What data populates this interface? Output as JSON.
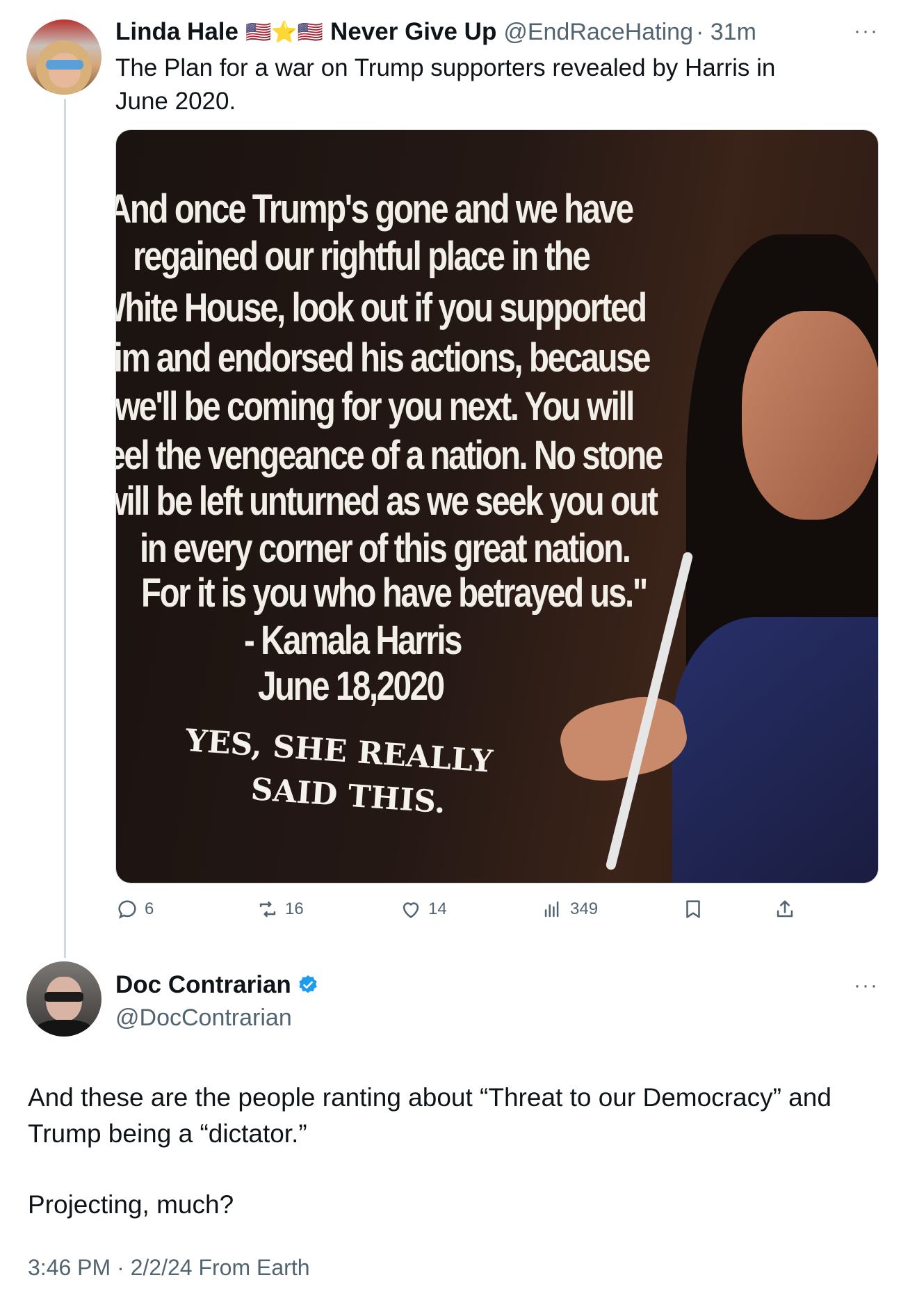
{
  "tweet1": {
    "display_name": "Linda Hale",
    "name_emojis": "🇺🇸⭐🇺🇸",
    "name_suffix": "Never Give Up",
    "handle": "@EndRaceHating",
    "time": "· 31m",
    "more": "···",
    "text": "The Plan for a war on Trump supporters revealed by Harris in June 2020.",
    "image": {
      "quote_lines": [
        "And once Trump's gone and we have",
        "regained our rightful place in the",
        "White House, look out if you supported",
        "him and endorsed his actions, because",
        "we'll be coming for you next. You will",
        "feel the vengeance of a nation. No stone",
        "will be left unturned as we seek you out",
        "in every corner of this great nation.",
        "For it is you who have betrayed us.\"",
        "- Kamala Harris",
        "June 18,2020"
      ],
      "caption_line1": "YES, SHE REALLY",
      "caption_line2": "SAID THIS."
    },
    "actions": {
      "replies": "6",
      "reposts": "16",
      "likes": "14",
      "views": "349"
    }
  },
  "tweet2": {
    "display_name": "Doc Contrarian",
    "verified": true,
    "handle": "@DocContrarian",
    "more": "···",
    "text_p1": "And these are the people ranting about “Threat to our Democracy” and Trump being a “dictator.”",
    "text_p2": "Projecting, much?",
    "timestamp": "3:46 PM · 2/2/24 From Earth"
  },
  "colors": {
    "text": "#0f1419",
    "muted": "#536471",
    "verified": "#1d9bf0",
    "thread_line": "#cfd9de"
  }
}
